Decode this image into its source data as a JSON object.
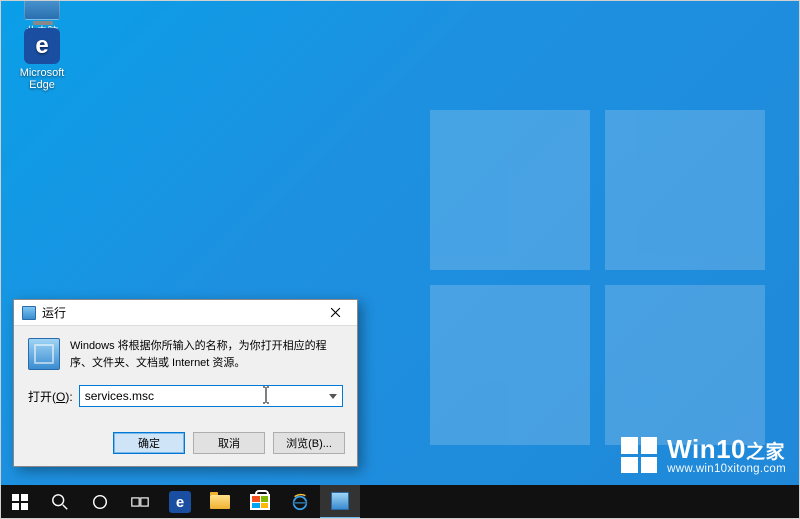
{
  "desktop": {
    "icons": {
      "this_pc_label": "此电脑",
      "edge_label": "Microsoft Edge",
      "edge_letter": "e"
    }
  },
  "run_dialog": {
    "title": "运行",
    "message": "Windows 将根据你所输入的名称，为你打开相应的程序、文件夹、文档或 Internet 资源。",
    "open_label_prefix": "打开(",
    "open_label_hotkey": "O",
    "open_label_suffix": "):",
    "input_value": "services.msc",
    "buttons": {
      "ok": "确定",
      "cancel": "取消",
      "browse": "浏览(B)..."
    }
  },
  "watermark": {
    "title_main": "Win10",
    "title_suffix": "之家",
    "url": "www.win10xitong.com"
  },
  "taskbar": {
    "edge_letter": "e"
  }
}
